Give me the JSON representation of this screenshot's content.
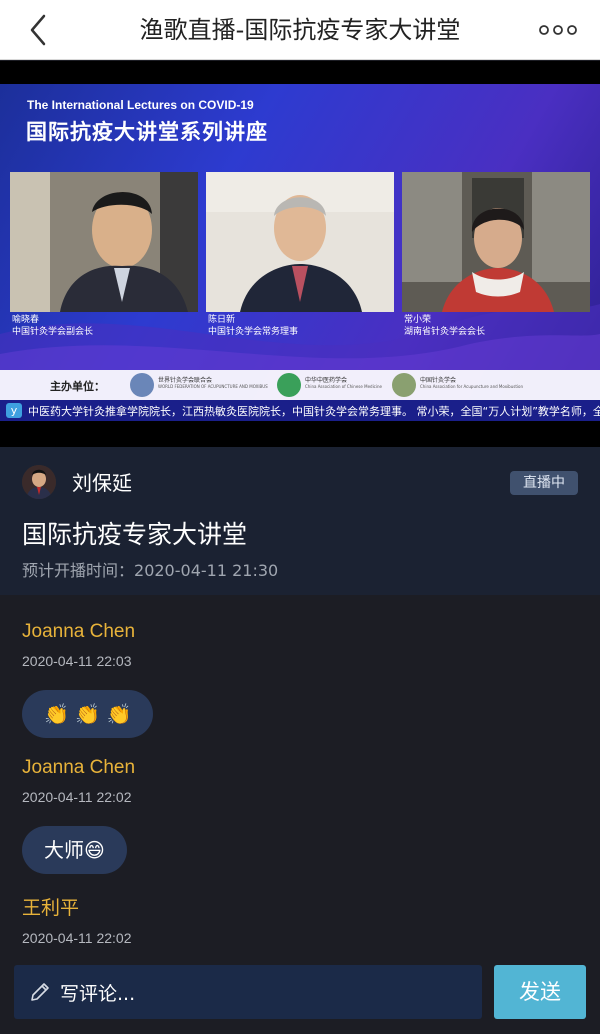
{
  "nav": {
    "title": "渔歌直播-国际抗疫专家大讲堂",
    "back_icon": "chevron-left-icon",
    "more_icon": "more-dots-icon"
  },
  "video": {
    "title_en": "The International Lectures on COVID-19",
    "title_cn": "国际抗疫大讲堂系列讲座",
    "speakers": [
      {
        "name": "喻晓春",
        "role": "中国针灸学会副会长"
      },
      {
        "name": "陈日新",
        "role": "中国针灸学会常务理事"
      },
      {
        "name": "常小荣",
        "role": "湖南省针灸学会会长"
      }
    ],
    "host_label": "主办单位：",
    "organizers": [
      {
        "name": "世界针灸学会联合会",
        "sub": "WORLD FEDERATION OF ACUPUNCTURE AND MOXIBUSTION SOCIETIES (WFAS)",
        "color": "#6a86b8"
      },
      {
        "name": "中华中医药学会",
        "sub": "China Association of Chinese Medicine",
        "color": "#3aa05a"
      },
      {
        "name": "中国针灸学会",
        "sub": "China Association for Acupuncture and Moxibustion",
        "color": "#8aa070"
      }
    ],
    "ticker_icon": "y",
    "ticker_text": "中医药大学针灸推拿学院院长，江西热敏灸医院院长，中国针灸学会常务理事。 常小荣，全国“万人计划”教学名师，全国第五、六"
  },
  "info": {
    "host_name": "刘保延",
    "live_badge": "直播中",
    "lecture_title": "国际抗疫专家大讲堂",
    "schedule_label": "预计开播时间：",
    "schedule_time": "2020-04-11 21:30"
  },
  "comments": [
    {
      "user": "Joanna Chen",
      "time": "2020-04-11 22:03",
      "message": "👏 👏 👏"
    },
    {
      "user": "Joanna Chen",
      "time": "2020-04-11 22:02",
      "message": "大师😄"
    },
    {
      "user": "王利平",
      "time": "2020-04-11 22:02",
      "message": ""
    }
  ],
  "composer": {
    "placeholder": "写评论...",
    "send_label": "发送",
    "icon": "pencil-icon"
  },
  "colors": {
    "username": "#e8b33a",
    "send_button": "#52b5d4",
    "panel": "#1b2232",
    "background": "#1c1d24"
  }
}
